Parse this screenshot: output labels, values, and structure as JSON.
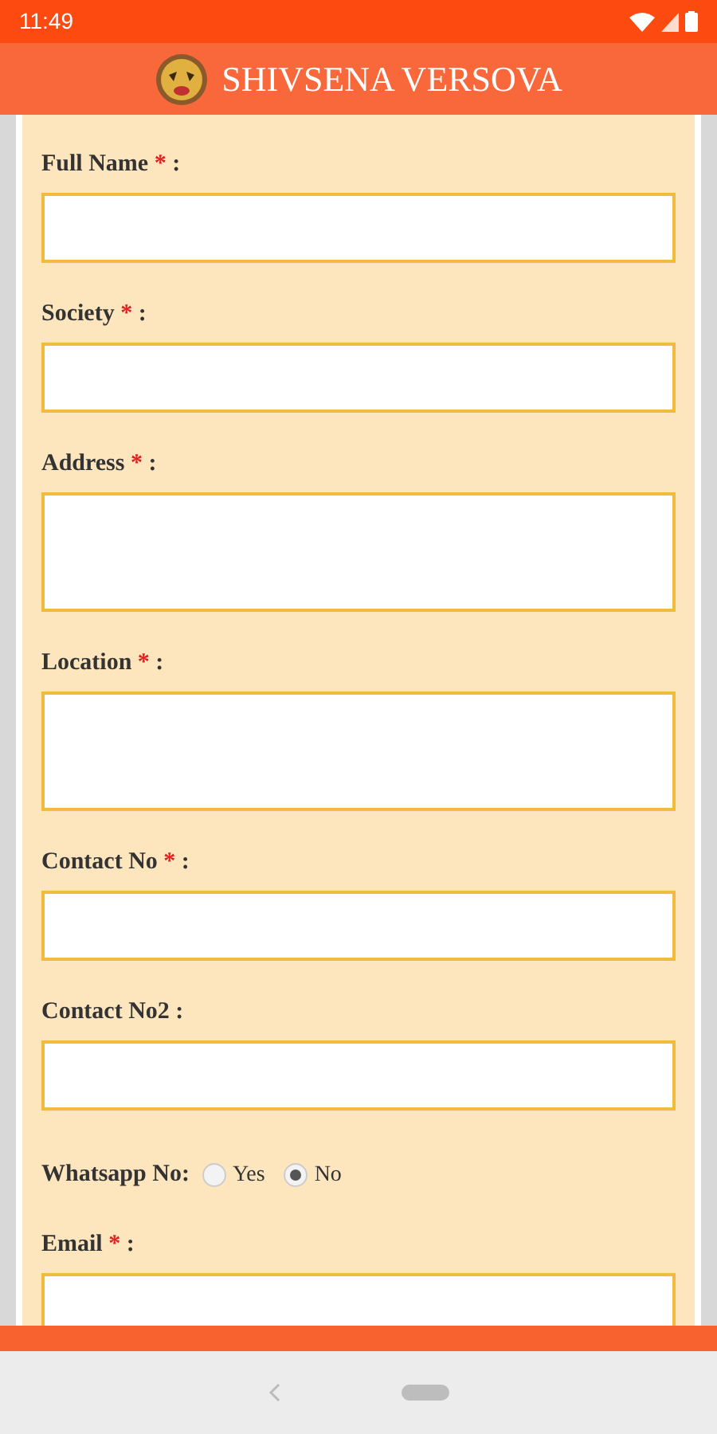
{
  "status_bar": {
    "time": "11:49"
  },
  "header": {
    "title": "SHIVSENA VERSOVA"
  },
  "fields": [
    {
      "kind": "input",
      "label": "Full Name",
      "required_mark": "*",
      "colon": ":"
    },
    {
      "kind": "input",
      "label": "Society",
      "required_mark": "*",
      "colon": ":"
    },
    {
      "kind": "textarea",
      "label": "Address",
      "required_mark": "*",
      "colon": ":"
    },
    {
      "kind": "textarea",
      "label": "Location",
      "required_mark": "*",
      "colon": ":"
    },
    {
      "kind": "input",
      "label": "Contact No",
      "required_mark": "*",
      "colon": ":"
    },
    {
      "kind": "input",
      "label": "Contact No2",
      "colon": ":"
    },
    {
      "kind": "radio",
      "label": "Whatsapp No:",
      "options": [
        {
          "label": "Yes",
          "selected": false
        },
        {
          "label": "No",
          "selected": true
        }
      ]
    },
    {
      "kind": "input",
      "label": "Email",
      "required_mark": "*",
      "colon": ":"
    }
  ]
}
